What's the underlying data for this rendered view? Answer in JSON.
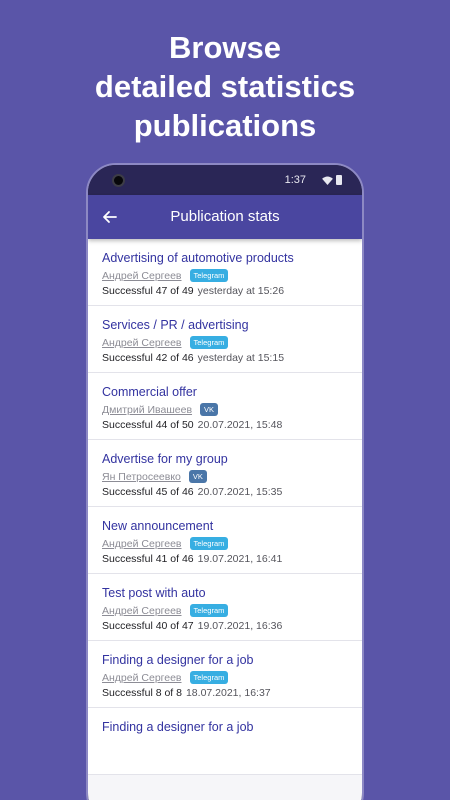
{
  "headline": [
    "Browse",
    "detailed statistics",
    "publications"
  ],
  "status": {
    "time": "1:37"
  },
  "appbar": {
    "title": "Publication stats"
  },
  "colors": {
    "telegram": "#37aee2",
    "vk": "#4a76a8"
  },
  "items": [
    {
      "title": "Advertising of automotive products",
      "author": "Андрей Сергеев",
      "network": "Telegram",
      "network_color": "#37aee2",
      "success": "Successful 47 of 49",
      "date": "yesterday at 15:26"
    },
    {
      "title": "Services / PR / advertising",
      "author": "Андрей Сергеев",
      "network": "Telegram",
      "network_color": "#37aee2",
      "success": "Successful 42 of 46",
      "date": "yesterday at 15:15"
    },
    {
      "title": "Commercial offer",
      "author": "Дмитрий Ивашеев",
      "network": "VK",
      "network_color": "#4a76a8",
      "success": "Successful 44 of 50",
      "date": "20.07.2021, 15:48"
    },
    {
      "title": "Advertise for my group",
      "author": "Ян Петросеевко",
      "network": "VK",
      "network_color": "#4a76a8",
      "success": "Successful 45 of 46",
      "date": "20.07.2021, 15:35"
    },
    {
      "title": "New announcement",
      "author": "Андрей Сергеев",
      "network": "Telegram",
      "network_color": "#37aee2",
      "success": "Successful 41 of 46",
      "date": "19.07.2021, 16:41"
    },
    {
      "title": "Test post with auto",
      "author": "Андрей Сергеев",
      "network": "Telegram",
      "network_color": "#37aee2",
      "success": "Successful 40 of 47",
      "date": "19.07.2021, 16:36"
    },
    {
      "title": "Finding a designer for a job",
      "author": "Андрей Сергеев",
      "network": "Telegram",
      "network_color": "#37aee2",
      "success": "Successful 8 of 8",
      "date": "18.07.2021, 16:37"
    },
    {
      "title": "Finding a designer for a job",
      "author": "",
      "network": "",
      "network_color": "",
      "success": "",
      "date": ""
    }
  ]
}
